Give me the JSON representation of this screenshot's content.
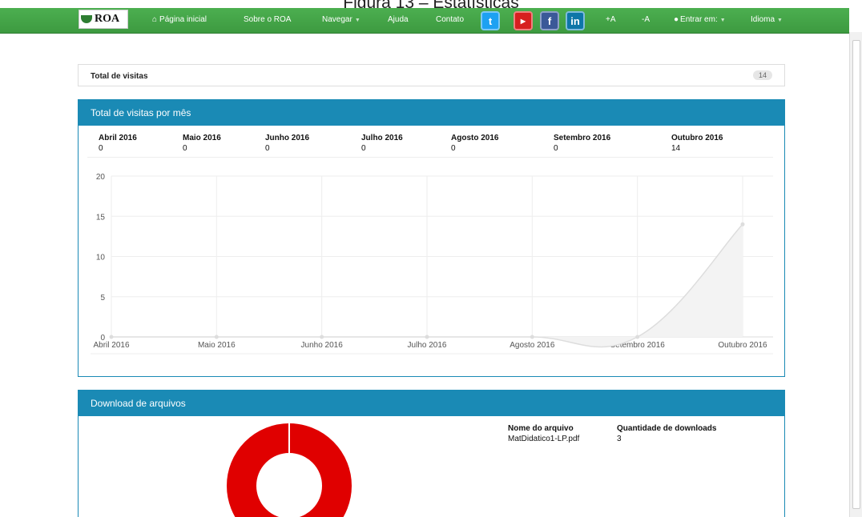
{
  "caption": "Figura 13 – Estatísticas",
  "navbar": {
    "logo_text": "ROA",
    "home": "Página inicial",
    "about": "Sobre o ROA",
    "browse": "Navegar",
    "help": "Ajuda",
    "contact": "Contato",
    "social": {
      "twitter": "twitter-icon",
      "youtube": "youtube-icon",
      "facebook": "facebook-icon",
      "linkedin": "linkedin-icon"
    },
    "font_increase": "+A",
    "font_decrease": "-A",
    "login": "Entrar em:",
    "language": "Idioma"
  },
  "total_visits": {
    "label": "Total de visitas",
    "count": "14"
  },
  "visits_by_month": {
    "title": "Total de visitas por mês",
    "months": [
      {
        "name": "Abril 2016",
        "value": "0"
      },
      {
        "name": "Maio 2016",
        "value": "0"
      },
      {
        "name": "Junho 2016",
        "value": "0"
      },
      {
        "name": "Julho 2016",
        "value": "0"
      },
      {
        "name": "Agosto 2016",
        "value": "0"
      },
      {
        "name": "Setembro 2016",
        "value": "0"
      },
      {
        "name": "Outubro 2016",
        "value": "14"
      }
    ]
  },
  "downloads": {
    "title": "Download de arquivos",
    "col_file": "Nome do arquivo",
    "col_count": "Quantidade de downloads",
    "rows": [
      {
        "file": "MatDidatico1-LP.pdf",
        "count": "3"
      }
    ]
  },
  "chart_data": [
    {
      "type": "area",
      "categories": [
        "Abril 2016",
        "Maio 2016",
        "Junho 2016",
        "Julho 2016",
        "Agosto 2016",
        "Setembro 2016",
        "Outubro 2016"
      ],
      "values": [
        0,
        0,
        0,
        0,
        0,
        0,
        14
      ],
      "ylim": [
        0,
        20
      ],
      "yticks": [
        0,
        5,
        10,
        15,
        20
      ],
      "grid": true,
      "colors": {
        "line": "#dddddd",
        "fill": "#f3f3f3",
        "point": "#dddddd"
      }
    },
    {
      "type": "pie",
      "categories": [
        "MatDidatico1-LP.pdf"
      ],
      "values": [
        3
      ],
      "donut": true,
      "colors": [
        "#e00000"
      ]
    }
  ]
}
